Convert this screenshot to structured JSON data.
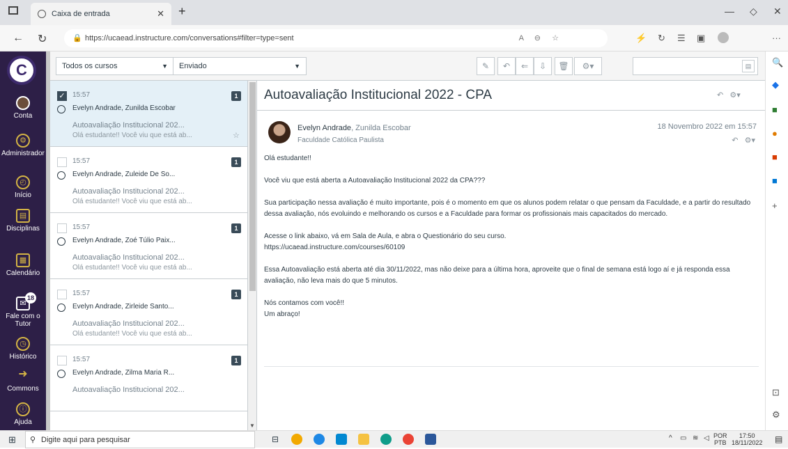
{
  "browser": {
    "tab_title": "Caixa de entrada",
    "url": "https://ucaead.instructure.com/conversations#filter=type=sent",
    "address_icons": [
      "A͡",
      "⊖",
      "☆"
    ]
  },
  "gnav": {
    "items": [
      {
        "label": "Conta"
      },
      {
        "label": "Administrador"
      },
      {
        "label": "Início"
      },
      {
        "label": "Disciplinas"
      },
      {
        "label": "Calendário"
      },
      {
        "label": "Fale com o Tutor",
        "badge": "18"
      },
      {
        "label": "Histórico"
      },
      {
        "label": "Commons"
      },
      {
        "label": "Ajuda"
      }
    ]
  },
  "toolbar": {
    "course_filter": "Todos os cursos",
    "type_filter": "Enviado",
    "search_placeholder": ""
  },
  "messages": [
    {
      "time": "15:57",
      "count": "1",
      "participants": "Evelyn Andrade, Zunilda Escobar",
      "subject": "Autoavaliação Institucional 202...",
      "preview": "Olá estudante!! Você viu que está ab...",
      "selected": true
    },
    {
      "time": "15:57",
      "count": "1",
      "participants": "Evelyn Andrade, Zuleide De So...",
      "subject": "Autoavaliação Institucional 202...",
      "preview": "Olá estudante!! Você viu que está ab..."
    },
    {
      "time": "15:57",
      "count": "1",
      "participants": "Evelyn Andrade, Zoé Túlio Paix...",
      "subject": "Autoavaliação Institucional 202...",
      "preview": "Olá estudante!! Você viu que está ab..."
    },
    {
      "time": "15:57",
      "count": "1",
      "participants": "Evelyn Andrade, Zirleide Santo...",
      "subject": "Autoavaliação Institucional 202...",
      "preview": "Olá estudante!! Você viu que está ab..."
    },
    {
      "time": "15:57",
      "count": "1",
      "participants": "Evelyn Andrade, Zilma Maria R...",
      "subject": "Autoavaliação Institucional 202...",
      "preview": ""
    }
  ],
  "view": {
    "title": "Autoavaliação Institucional 2022 - CPA",
    "sender": "Evelyn Andrade",
    "recipients": ", Zunilda Escobar",
    "org": "Faculdade Católica Paulista",
    "date": "18 Novembro 2022 em 15:57",
    "body": [
      "Olá estudante!!",
      "Você viu que está aberta a Autoavaliação Institucional 2022 da CPA???",
      "Sua participação nessa avaliação é muito importante, pois é o momento em que os alunos podem relatar o que pensam da Faculdade, e a partir do resultado dessa avaliação, nós evoluindo e melhorando os cursos e a Faculdade para formar os profissionais mais capacitados do mercado.",
      "Acesse o link abaixo, vá em Sala de Aula, e abra o Questionário do seu curso.",
      "https://ucaead.instructure.com/courses/60109",
      "Essa Autoavaliação está aberta até dia 30/11/2022, mas não deixe para a última hora, aproveite que o final de semana está logo aí e já responda essa avaliação, não leva mais do que 5 minutos.",
      "Nós contamos com você!!",
      "Um abraço!"
    ]
  },
  "taskbar": {
    "search_placeholder": "Digite aqui para pesquisar",
    "lang1": "POR",
    "lang2": "PTB",
    "time": "17:50",
    "date": "18/11/2022"
  },
  "colors": {
    "nav_bg": "#2d1f47",
    "accent": "#d4b445",
    "selected_row": "#e4f0f7"
  }
}
